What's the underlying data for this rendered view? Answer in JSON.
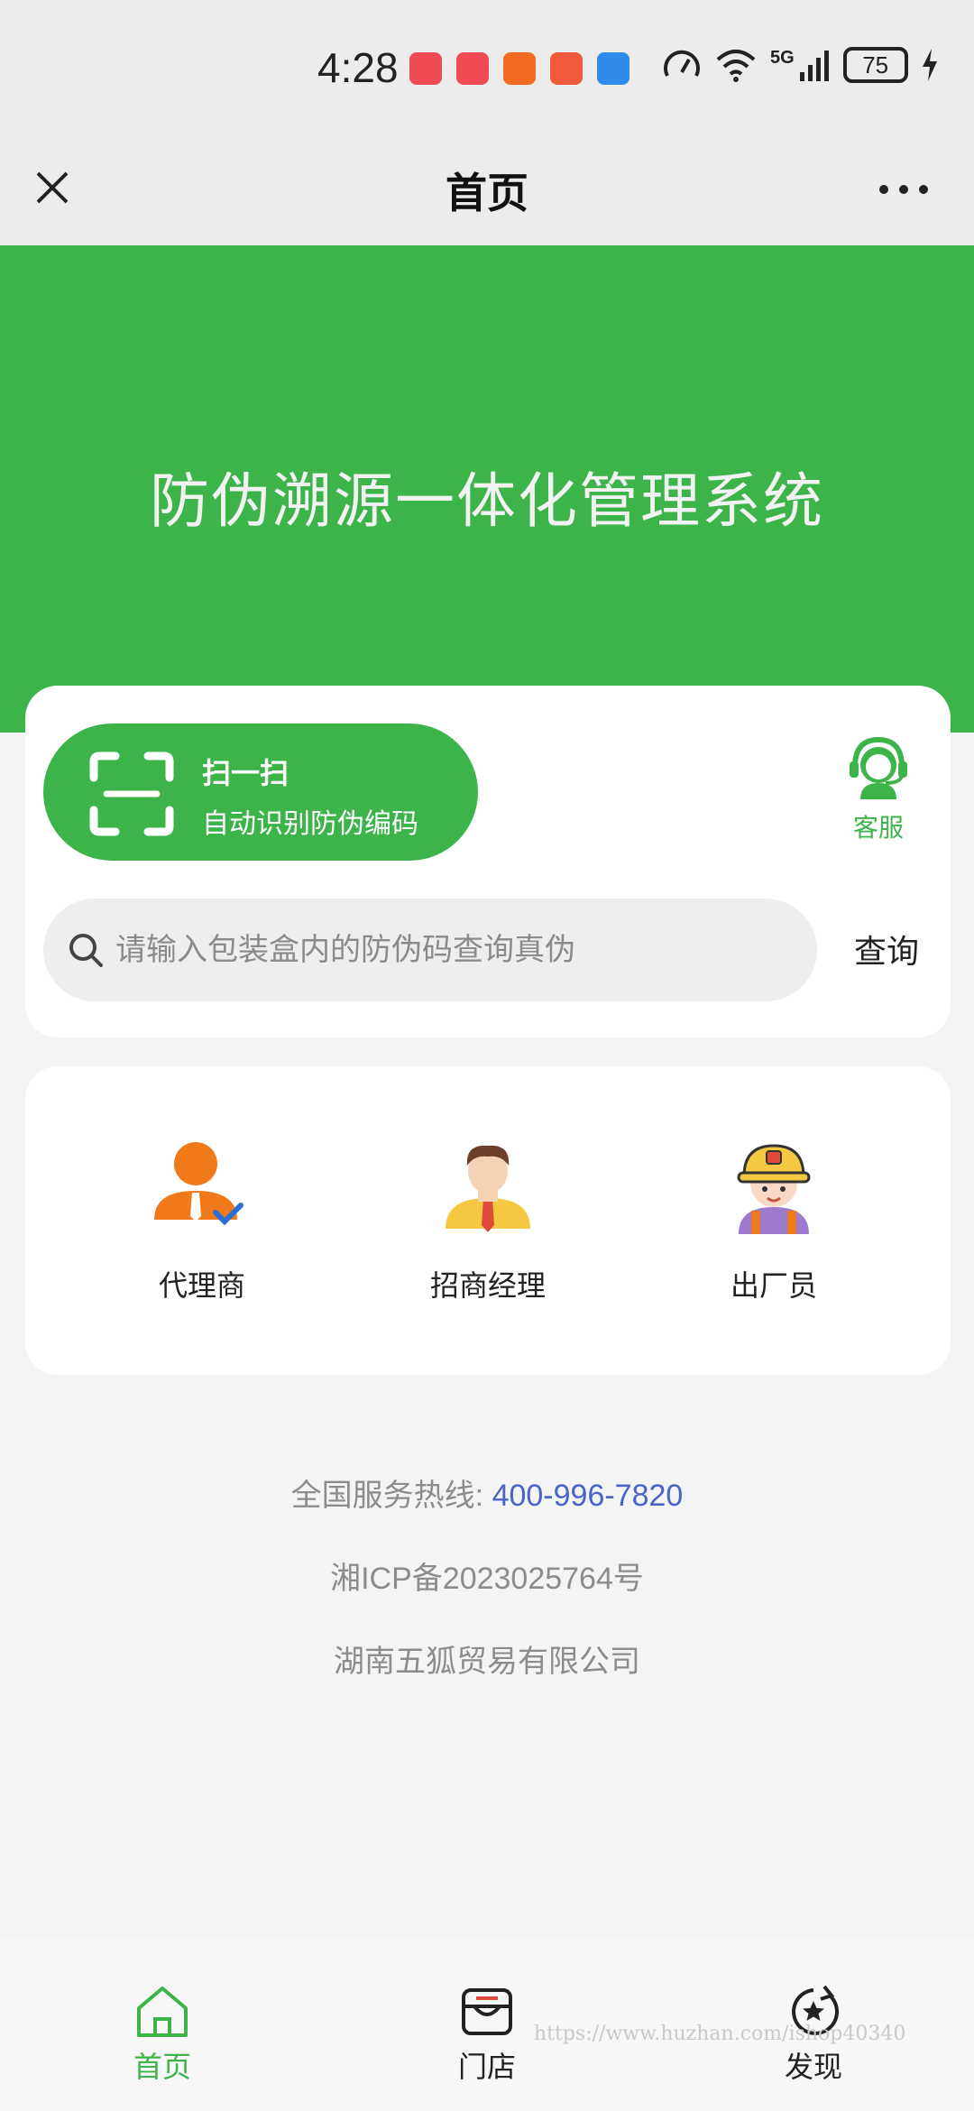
{
  "status_bar": {
    "time": "4:28",
    "network": "5G",
    "battery": "75",
    "app_icons": [
      "huawei-store-icon",
      "huawei-store-icon",
      "kuaishou-icon",
      "orange-app-icon",
      "shield-app-icon"
    ]
  },
  "nav": {
    "title": "首页"
  },
  "banner": {
    "title": "防伪溯源一体化管理系统"
  },
  "scan": {
    "title": "扫一扫",
    "subtitle": "自动识别防伪编码"
  },
  "service": {
    "label": "客服"
  },
  "search": {
    "placeholder": "请输入包装盒内的防伪码查询真伪",
    "button_label": "查询"
  },
  "roles": [
    {
      "label": "代理商"
    },
    {
      "label": "招商经理"
    },
    {
      "label": "出厂员"
    }
  ],
  "footer": {
    "hotline_label": "全国服务热线:",
    "hotline_number": "400-996-7820",
    "icp": "湘ICP备2023025764号",
    "company": "湖南五狐贸易有限公司"
  },
  "tabs": [
    {
      "label": "首页",
      "active": true
    },
    {
      "label": "门店",
      "active": false
    },
    {
      "label": "发现",
      "active": false
    }
  ],
  "watermark": "https://www.huzhan.com/ishop40340",
  "colors": {
    "brand_green": "#3cb44a",
    "hotline_blue": "#4a64c8",
    "agent_orange": "#f07a1a"
  }
}
